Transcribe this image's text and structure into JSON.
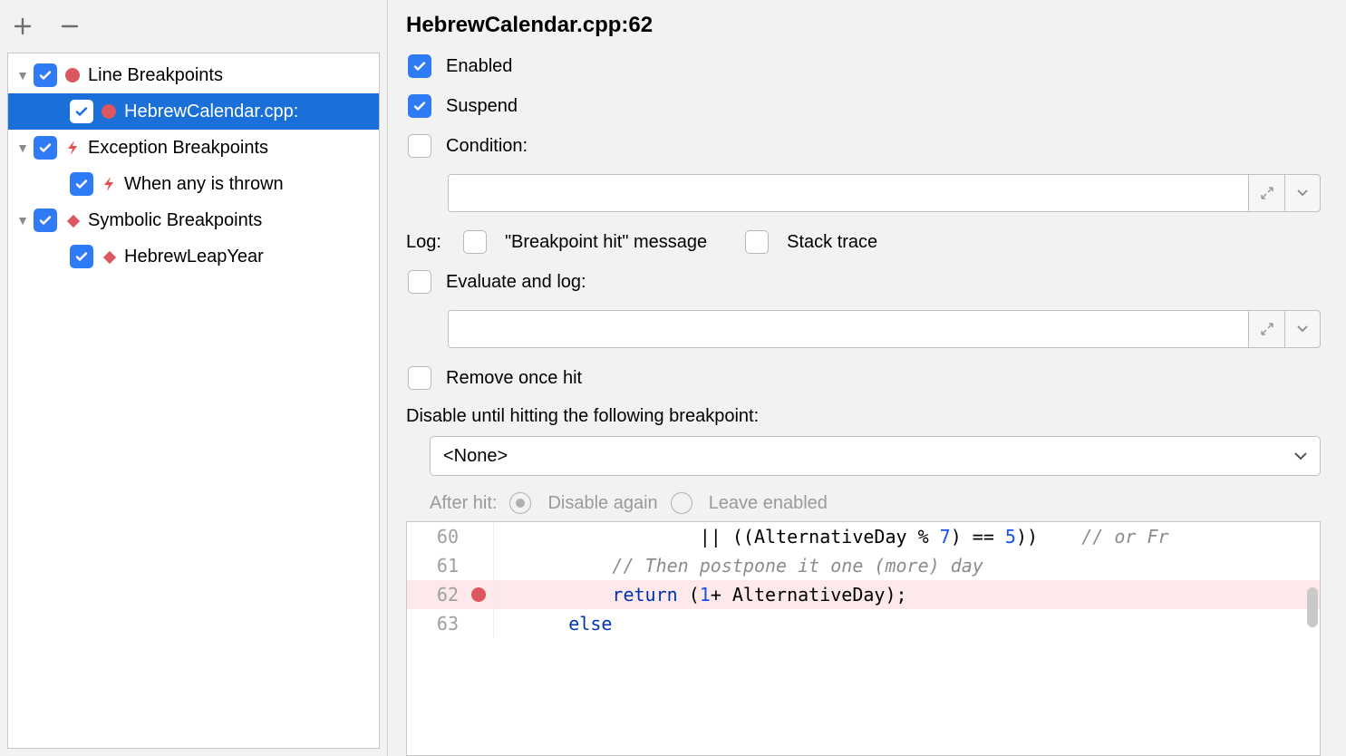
{
  "title": "HebrewCalendar.cpp:62",
  "tree": {
    "items": [
      {
        "label": "Line Breakpoints",
        "icon": "circle",
        "checked": true,
        "kind": "group"
      },
      {
        "label": "HebrewCalendar.cpp:",
        "icon": "circle",
        "checked": true,
        "kind": "child",
        "selected": true
      },
      {
        "label": "Exception Breakpoints",
        "icon": "bolt",
        "checked": true,
        "kind": "group"
      },
      {
        "label": "When any is thrown",
        "icon": "bolt",
        "checked": true,
        "kind": "child"
      },
      {
        "label": "Symbolic Breakpoints",
        "icon": "diamond",
        "checked": true,
        "kind": "group"
      },
      {
        "label": "HebrewLeapYear",
        "icon": "diamond",
        "checked": true,
        "kind": "child"
      }
    ]
  },
  "options": {
    "enabled": {
      "label": "Enabled",
      "checked": true
    },
    "suspend": {
      "label": "Suspend",
      "checked": true
    },
    "condition": {
      "label": "Condition:",
      "checked": false
    },
    "logHead": "Log:",
    "logBpHit": {
      "label": "\"Breakpoint hit\" message",
      "checked": false
    },
    "logStack": {
      "label": "Stack trace",
      "checked": false
    },
    "evalLog": {
      "label": "Evaluate and log:",
      "checked": false
    },
    "removeOnce": {
      "label": "Remove once hit",
      "checked": false
    },
    "disableUntil": "Disable until hitting the following breakpoint:",
    "disableSelect": "<None>",
    "afterHit": "After hit:",
    "afterDisable": "Disable again",
    "afterLeave": "Leave enabled"
  },
  "code": {
    "lines": [
      {
        "n": "60",
        "bp": false,
        "hl": false
      },
      {
        "n": "61",
        "bp": false,
        "hl": false
      },
      {
        "n": "62",
        "bp": true,
        "hl": true
      },
      {
        "n": "63",
        "bp": false,
        "hl": false
      }
    ],
    "t60a": "|| ((AlternativeDay % ",
    "t60b": "7",
    "t60c": ") == ",
    "t60d": "5",
    "t60e": "))",
    "t60f": "// or Fr",
    "t61": "// Then postpone it one (more) day",
    "t62a": "return",
    "t62b": " (",
    "t62c": "1",
    "t62d": "+ AlternativeDay);",
    "t63": "else"
  }
}
